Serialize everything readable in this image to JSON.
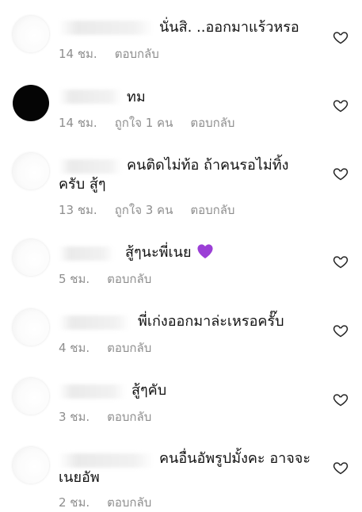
{
  "comments": [
    {
      "lines": [
        "นั่นสิ. ..ออกมาแร้วหรอ"
      ],
      "time": "14 ชม.",
      "likes": "",
      "reply_label": "ตอบกลับ"
    },
    {
      "lines": [
        "ทม"
      ],
      "time": "14 ชม.",
      "likes": "ถูกใจ 1 คน",
      "reply_label": "ตอบกลับ"
    },
    {
      "lines": [
        "คนติดไม่ท้อ ถ้าคนรอไม่ทิ้ง",
        "ครับ สู้ๆ"
      ],
      "time": "13 ชม.",
      "likes": "ถูกใจ 3 คน",
      "reply_label": "ตอบกลับ"
    },
    {
      "lines": [
        "สู้ๆนะพี่เนย"
      ],
      "emoji": "purple-heart",
      "time": "5 ชม.",
      "likes": "",
      "reply_label": "ตอบกลับ"
    },
    {
      "lines": [
        "พี่เก่งออกมาล่ะเหรอครั๊บ"
      ],
      "time": "4 ชม.",
      "likes": "",
      "reply_label": "ตอบกลับ"
    },
    {
      "lines": [
        "สู้ๆคับ"
      ],
      "time": "3 ชม.",
      "likes": "",
      "reply_label": "ตอบกลับ"
    },
    {
      "lines": [
        "คนอื่นอัพรูปมั้งคะ อาจจะ",
        "เนยอัพ"
      ],
      "time": "2 ชม.",
      "likes": "",
      "reply_label": "ตอบกลับ"
    }
  ],
  "icons": {
    "like": "heart-outline-icon",
    "emoji_color": "#9b3fd6"
  }
}
